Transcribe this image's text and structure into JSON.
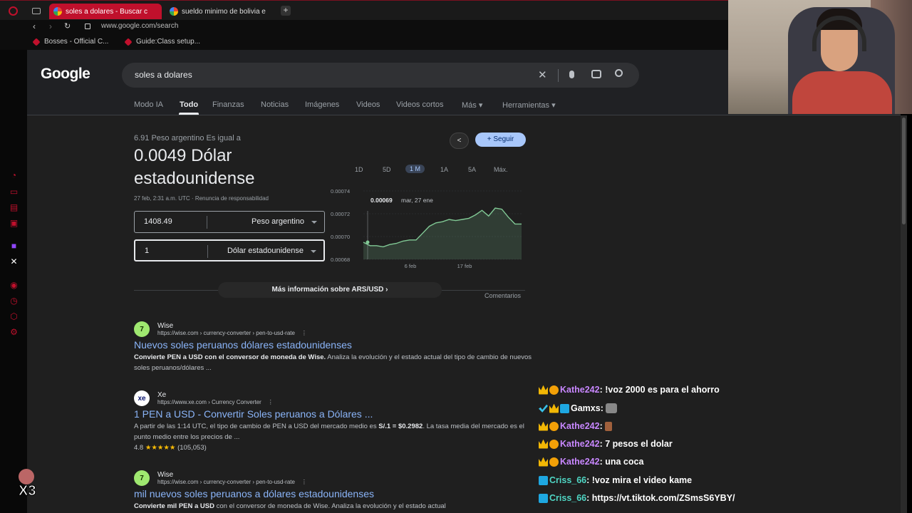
{
  "browser": {
    "tabs": [
      {
        "title": "soles a dolares - Buscar c",
        "active": true
      },
      {
        "title": "sueldo minimo de bolivia e",
        "active": false
      }
    ],
    "address": "www.google.com/search",
    "bookmarks": [
      "Bosses - Official C...",
      "Guide:Class setup..."
    ]
  },
  "google": {
    "logo": "Google",
    "query": "soles a dolares",
    "nav": [
      "Modo IA",
      "Todo",
      "Finanzas",
      "Noticias",
      "Imágenes",
      "Videos",
      "Videos cortos",
      "Más",
      "Herramientas"
    ],
    "active_nav": "Todo",
    "converter": {
      "from_line": "6.91 Peso argentino Es igual a",
      "result": "0.0049 Dólar estadounidense",
      "timestamp": "27 feb, 2:31 a.m. UTC · Renuncia de responsabilidad",
      "from_value": "1408.49",
      "from_currency": "Peso argentino",
      "to_value": "1",
      "to_currency": "Dólar estadounidense",
      "follow": "Seguir",
      "ranges": [
        "1D",
        "5D",
        "1 M",
        "1A",
        "5A",
        "Máx."
      ],
      "active_range": "1 M",
      "more_info": "Más información sobre ARS/USD",
      "feedback": "Comentarios"
    },
    "results": [
      {
        "site": "Wise",
        "url": "https://wise.com › currency-converter › pen-to-usd-rate",
        "title": "Nuevos soles peruanos dólares estadounidenses",
        "snippet_bold": "Convierte PEN a USD con el conversor de moneda de Wise.",
        "snippet": " Analiza la evolución y el estado actual del tipo de cambio de nuevos soles peruanos/dólares ..."
      },
      {
        "site": "Xe",
        "url": "https://www.xe.com › Currency Converter",
        "title": "1 PEN a USD - Convertir Soles peruanos a Dólares ...",
        "snippet": "A partir de las 1:14 UTC, el tipo de cambio de PEN a USD del mercado medio es ",
        "snippet_bold": "S/.1 = $0.2982",
        "snippet_end": ". La tasa media del mercado es el punto medio entre los precios de ...",
        "rating": "4.8",
        "stars": "★★★★★",
        "reviews": "(105,053)"
      },
      {
        "site": "Wise",
        "url": "https://wise.com › currency-converter › pen-to-usd-rate",
        "title": "mil nuevos soles peruanos a dólares estadounidenses",
        "snippet_bold": "Convierte mil PEN a USD",
        "snippet": " con el conversor de moneda de Wise. Analiza la evolución y el estado actual"
      }
    ]
  },
  "chart_data": {
    "type": "area",
    "x_ticks": [
      "6 feb",
      "17 feb"
    ],
    "y_ticks": [
      "0.00074",
      "0.00072",
      "0.00070",
      "0.00068"
    ],
    "ylim": [
      0.00068,
      0.00074
    ],
    "tooltip_value": "0.00069",
    "tooltip_date": "mar, 27 ene",
    "values": [
      0.000695,
      0.000692,
      0.000692,
      0.000691,
      0.000693,
      0.000694,
      0.000696,
      0.000697,
      0.000697,
      0.000703,
      0.000709,
      0.000712,
      0.000713,
      0.000715,
      0.000714,
      0.000715,
      0.000716,
      0.000719,
      0.000723,
      0.000718,
      0.000725,
      0.000724,
      0.000717,
      0.000711,
      0.000711
    ],
    "line_color": "#81c995"
  },
  "chat": [
    {
      "badges": [
        "crown",
        "one"
      ],
      "user": "Kathe242",
      "color": "#c887ff",
      "msg": "!voz 2000 es para el ahorro"
    },
    {
      "badges": [
        "check",
        "crown",
        "sub"
      ],
      "user": "Gamxs",
      "color": "#ffffff",
      "msg": ""
    },
    {
      "badges": [
        "crown",
        "one"
      ],
      "user": "Kathe242",
      "color": "#c887ff",
      "msg": ""
    },
    {
      "badges": [
        "crown",
        "one"
      ],
      "user": "Kathe242",
      "color": "#c887ff",
      "msg": "7 pesos el dolar"
    },
    {
      "badges": [
        "crown",
        "one"
      ],
      "user": "Kathe242",
      "color": "#c887ff",
      "msg": "una coca"
    },
    {
      "badges": [
        "sub"
      ],
      "user": "Criss_66",
      "color": "#4fd6c4",
      "msg": "!voz mira el video kame"
    },
    {
      "badges": [
        "sub"
      ],
      "user": "Criss_66",
      "color": "#4fd6c4",
      "msg": "https://vt.tiktok.com/ZSmsS6YBY/"
    }
  ],
  "overlay": {
    "multiplier": "X3"
  }
}
